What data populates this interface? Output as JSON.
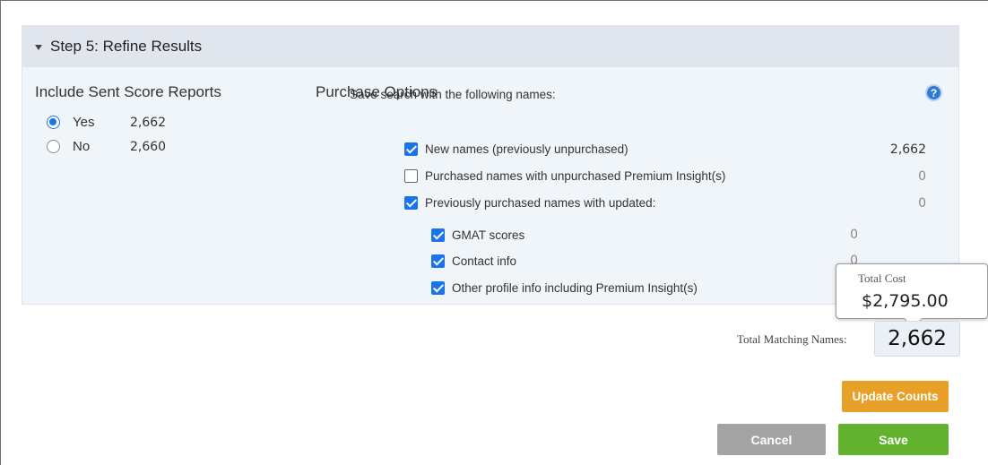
{
  "panel": {
    "title": "Step 5: Refine Results"
  },
  "sent_score": {
    "title": "Include Sent Score Reports",
    "options": [
      {
        "label": "Yes",
        "count": "2,662",
        "selected": true
      },
      {
        "label": "No",
        "count": "2,660",
        "selected": false
      }
    ]
  },
  "purchase": {
    "title": "Purchase Options",
    "subtitle": "Save search with the following names:",
    "help_icon": "question-circle-icon",
    "items": [
      {
        "label": "New names (previously unpurchased)",
        "checked": true,
        "count": "2,662"
      },
      {
        "label": "Purchased names with unpurchased Premium Insight(s)",
        "checked": false,
        "count": "0"
      },
      {
        "label": "Previously purchased names with updated:",
        "checked": true,
        "count": "0"
      }
    ],
    "sub_items": [
      {
        "label": "GMAT scores",
        "checked": true,
        "count": "0"
      },
      {
        "label": "Contact info",
        "checked": true,
        "count": "0"
      },
      {
        "label": "Other profile info including Premium Insight(s)",
        "checked": true,
        "count": ""
      }
    ]
  },
  "tooltip": {
    "label": "Total Cost",
    "value": "$2,795.00"
  },
  "totals": {
    "label": "Total Matching Names:",
    "value": "2,662"
  },
  "buttons": {
    "update": "Update Counts",
    "cancel": "Cancel",
    "save": "Save"
  },
  "colors": {
    "accent": "#1a73e8",
    "update": "#e8a028",
    "save": "#63b22f",
    "cancel": "#a3a3a3"
  }
}
